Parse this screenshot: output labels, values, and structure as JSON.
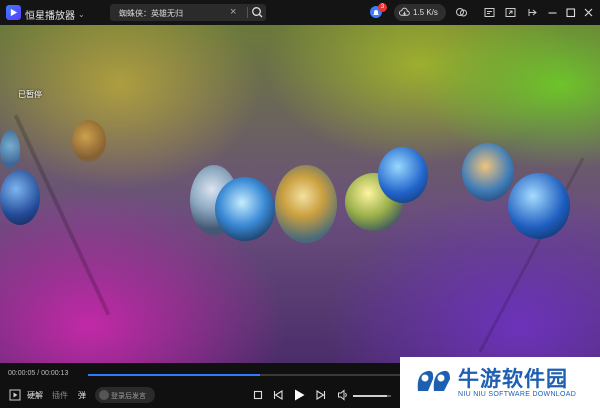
{
  "titlebar": {
    "app_title": "恒星播放器",
    "search_value": "蜘蛛侠：英雄无归",
    "notification_count": "3",
    "speed": "1.5 K/s"
  },
  "video": {
    "status_text": "已暂停"
  },
  "controls": {
    "time": "00:00:05 / 00:00:13",
    "progress_fraction": 0.55,
    "hw_decode_label": "硬解",
    "plugin_label": "插件",
    "danmaku_label": "弹",
    "danmaku_placeholder": "登录后发言",
    "volume_fraction": 0.9
  },
  "watermark": {
    "title": "牛游软件园",
    "subtitle": "NIU NIU SOFTWARE DOWNLOAD"
  },
  "colors": {
    "accent": "#2f7bff",
    "titlebar_bg": "#141414",
    "badge": "#e63535",
    "watermark_blue": "#1d5fb0"
  },
  "icons": [
    "app-logo-icon",
    "chevron-down-icon",
    "close-icon",
    "search-icon",
    "notification-icon",
    "cloud-download-icon",
    "chat-icon",
    "screen-icon",
    "pip-icon",
    "pin-icon",
    "minimize-icon",
    "maximize-icon",
    "window-close-icon",
    "playlist-icon",
    "stop-icon",
    "prev-icon",
    "play-icon",
    "next-icon",
    "volume-icon"
  ]
}
